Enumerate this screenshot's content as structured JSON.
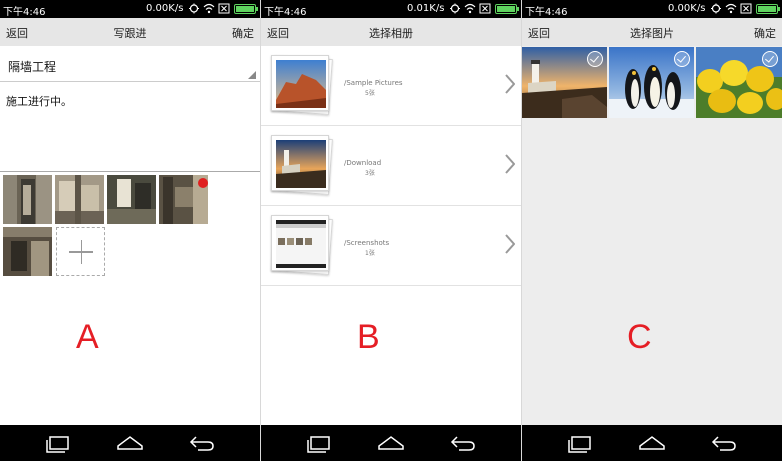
{
  "status": {
    "time": "下午4:46"
  },
  "panels": [
    {
      "status_speed": "0.00K/s",
      "header": {
        "back": "返回",
        "title": "写跟进",
        "confirm": "确定"
      },
      "project": "隔墙工程",
      "progress_text": "施工进行中。",
      "letter": "A"
    },
    {
      "status_speed": "0.01K/s",
      "header": {
        "back": "返回",
        "title": "选择相册"
      },
      "albums": [
        {
          "name": "/Sample Pictures",
          "count": "5张"
        },
        {
          "name": "/Download",
          "count": "3张"
        },
        {
          "name": "/Screenshots",
          "count": "1张"
        }
      ],
      "letter": "B"
    },
    {
      "status_speed": "0.00K/s",
      "header": {
        "back": "返回",
        "title": "选择图片",
        "confirm": "确定"
      },
      "photos": [
        "lighthouse",
        "penguins",
        "tulips"
      ],
      "letter": "C"
    }
  ],
  "icons": [
    "recent-apps-icon",
    "home-icon",
    "back-icon",
    "wifi-icon",
    "battery-icon",
    "chevron-right-icon",
    "checkmark-icon",
    "add-icon"
  ],
  "colors": {
    "letter": "#e51e25",
    "battery": "#5fd35f",
    "topbar": "#e6e6e6"
  }
}
